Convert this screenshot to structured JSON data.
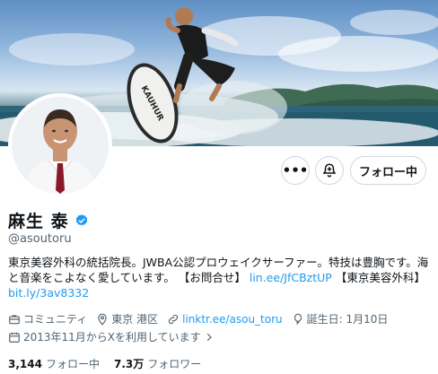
{
  "profile": {
    "display_name": "麻生 泰",
    "handle": "@asoutoru",
    "bio": {
      "text_1": "東京美容外科の統括院長。JWBA公認プロウェイクサーファー。特技は豊胸です。海と音楽をこよなく愛しています。 【お問合せ】",
      "link_1": "lin.ee/JfCBztUP",
      "text_2": "【東京美容外科】",
      "link_2": "bit.ly/3av8332"
    },
    "board_text": "KAUHUR"
  },
  "actions": {
    "more_label": "•••",
    "follow_label": "フォロー中"
  },
  "meta": {
    "category": "コミュニティ",
    "location": "東京 港区",
    "website": "linktr.ee/asou_toru",
    "birthday": "誕生日: 1月10日",
    "joined": "2013年11月からXを利用しています"
  },
  "counts": {
    "following_num": "3,144",
    "following_label": "フォロー中",
    "followers_num": "7.3万",
    "followers_label": "フォロワー"
  },
  "colors": {
    "accent": "#1d9bf0",
    "secondary_text": "#536471",
    "primary_text": "#0f1419",
    "border": "#cfd9de"
  },
  "icons": {
    "verified": "verified-badge-icon",
    "category": "briefcase-icon",
    "location": "location-pin-icon",
    "website": "link-icon",
    "birthday": "balloon-icon",
    "joined": "calendar-icon",
    "subscribe": "bell-plus-icon"
  }
}
